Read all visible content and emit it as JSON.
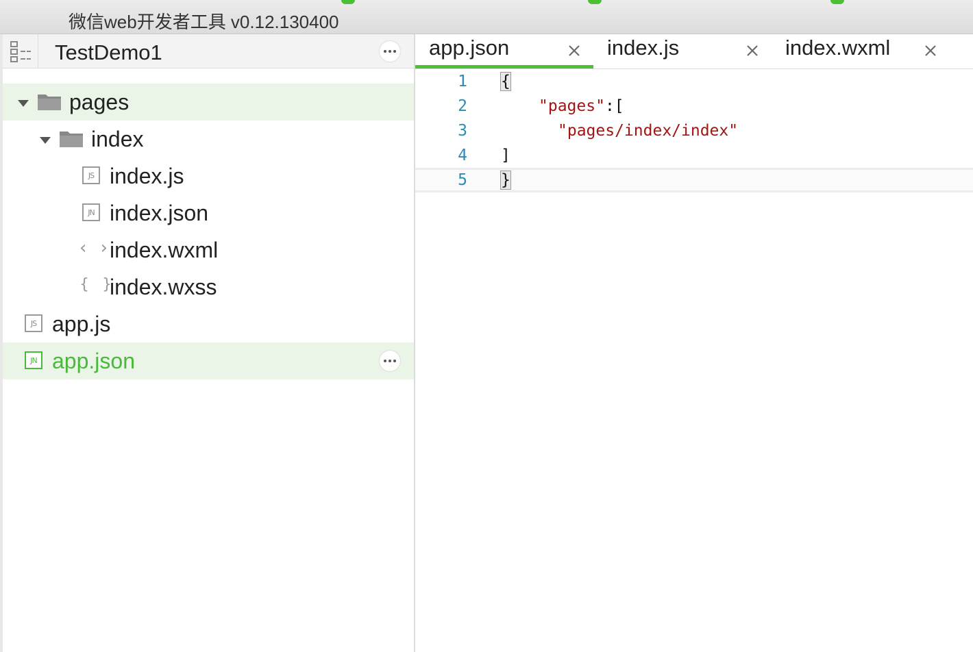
{
  "window": {
    "title": "微信web开发者工具 v0.12.130400"
  },
  "colors": {
    "accent": "#4cbf35",
    "selected_text": "#4ab83a",
    "selected_bg": "#eaf5e8",
    "line_number": "#2b8bb6",
    "string": "#a31515"
  },
  "sidebar": {
    "project_name": "TestDemo1",
    "toggle_icon": "file-tree-icon",
    "more_icon": "more-dots-icon",
    "tree": [
      {
        "label": "pages",
        "kind": "folder",
        "expanded": true
      },
      {
        "label": "index",
        "kind": "folder",
        "expanded": true
      },
      {
        "label": "index.js",
        "kind": "js",
        "badge": "JS"
      },
      {
        "label": "index.json",
        "kind": "json",
        "badge": "JN"
      },
      {
        "label": "index.wxml",
        "kind": "wxml",
        "glyph": "<>"
      },
      {
        "label": "index.wxss",
        "kind": "wxss",
        "glyph": "{}"
      },
      {
        "label": "app.js",
        "kind": "js",
        "badge": "JS"
      },
      {
        "label": "app.json",
        "kind": "json",
        "badge": "JN",
        "selected": true
      }
    ]
  },
  "tabs": [
    {
      "label": "app.json",
      "active": true
    },
    {
      "label": "index.js",
      "active": false
    },
    {
      "label": "index.wxml",
      "active": false
    }
  ],
  "editor": {
    "lines": [
      {
        "num": "1",
        "text": "{"
      },
      {
        "num": "2",
        "text": "\"pages\":["
      },
      {
        "num": "3",
        "text": "\"pages/index/index\""
      },
      {
        "num": "4",
        "text": "]"
      },
      {
        "num": "5",
        "text": "}"
      }
    ]
  }
}
